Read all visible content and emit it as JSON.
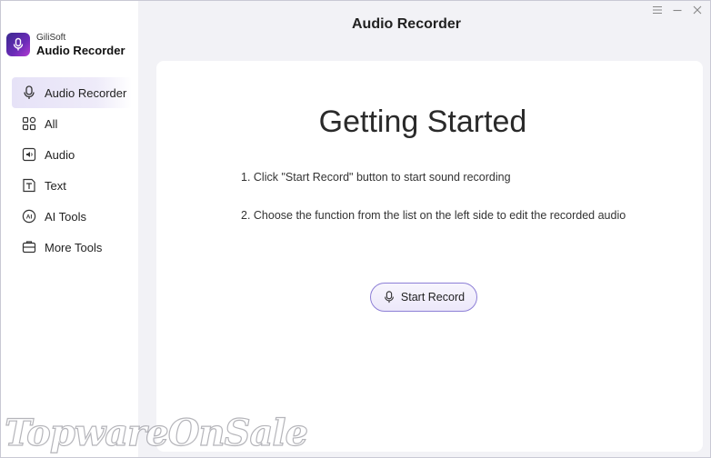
{
  "app": {
    "brand": "GiliSoft",
    "product": "Audio Recorder",
    "window_title": "Audio Recorder"
  },
  "window_controls": [
    "menu-icon",
    "minimize-icon",
    "close-icon"
  ],
  "sidebar": {
    "items": [
      {
        "label": "Audio Recorder",
        "icon": "microphone-icon",
        "active": true
      },
      {
        "label": "All",
        "icon": "grid-icon",
        "active": false
      },
      {
        "label": "Audio",
        "icon": "audio-file-icon",
        "active": false
      },
      {
        "label": "Text",
        "icon": "text-icon",
        "active": false
      },
      {
        "label": "AI Tools",
        "icon": "ai-icon",
        "active": false
      },
      {
        "label": "More Tools",
        "icon": "more-tools-icon",
        "active": false
      }
    ]
  },
  "main": {
    "heading": "Getting Started",
    "steps": [
      "1. Click \"Start Record\" button to start sound recording",
      "2. Choose the function from the list on the left side to edit the recorded audio"
    ],
    "start_button": "Start Record"
  },
  "watermark": "TopwareOnSale",
  "colors": {
    "accent": "#8d7fd6",
    "active_nav_bg": "#e6e2f7",
    "app_bg": "#f2f2f6"
  }
}
